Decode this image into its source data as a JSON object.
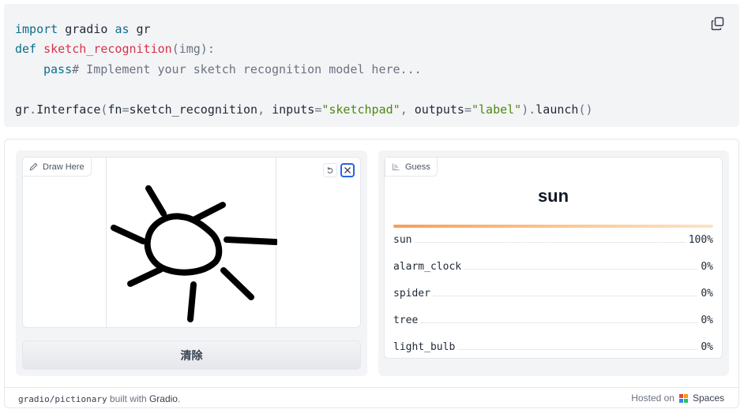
{
  "code": {
    "line1": {
      "kw1": "import",
      "mod": " gradio ",
      "kw2": "as",
      "alias": " gr"
    },
    "line2": {
      "kw": "def",
      "name": " sketch_recognition",
      "params": "(img):"
    },
    "line3": {
      "kw": "pass",
      "comment": "# Implement your sketch recognition model here..."
    },
    "line5": {
      "p1": "gr",
      "p2": ".",
      "p3": "Interface",
      "p4": "(",
      "p5": "fn",
      "p6": "=",
      "p7": "sketch_recognition",
      "p8": ", ",
      "p9": "inputs",
      "p10": "=",
      "p11": "\"sketchpad\"",
      "p12": ", ",
      "p13": "outputs",
      "p14": "=",
      "p15": "\"label\"",
      "p16": ").",
      "p17": "launch",
      "p18": "()"
    },
    "copy_icon": "copy-icon"
  },
  "sketchpad": {
    "label": "Draw Here",
    "label_icon": "pencil-icon",
    "undo_icon": "undo-icon",
    "clear_icon": "close-icon",
    "clear_button": "清除"
  },
  "output": {
    "label": "Guess",
    "label_icon": "bar-chart-icon",
    "prediction": "sun",
    "top_confidence": 1.0,
    "confidences": [
      {
        "label": "sun",
        "value": "100%"
      },
      {
        "label": "alarm_clock",
        "value": "0%"
      },
      {
        "label": "spider",
        "value": "0%"
      },
      {
        "label": "tree",
        "value": "0%"
      },
      {
        "label": "light_bulb",
        "value": "0%"
      }
    ]
  },
  "footer": {
    "repo": "gradio/pictionary",
    "built_with": " built with ",
    "gradio": "Gradio",
    "period": ".",
    "hosted_on": "Hosted on",
    "spaces": "Spaces",
    "logo_colors": [
      "#ef4444",
      "#f59e0b",
      "#3b82f6",
      "#22c55e"
    ]
  },
  "colors": {
    "accent": "#2563eb",
    "confidence_bar": "#f59e5b",
    "keyword": "#0d6e8a",
    "function_name": "#d6334a",
    "string": "#4d8a0f"
  }
}
